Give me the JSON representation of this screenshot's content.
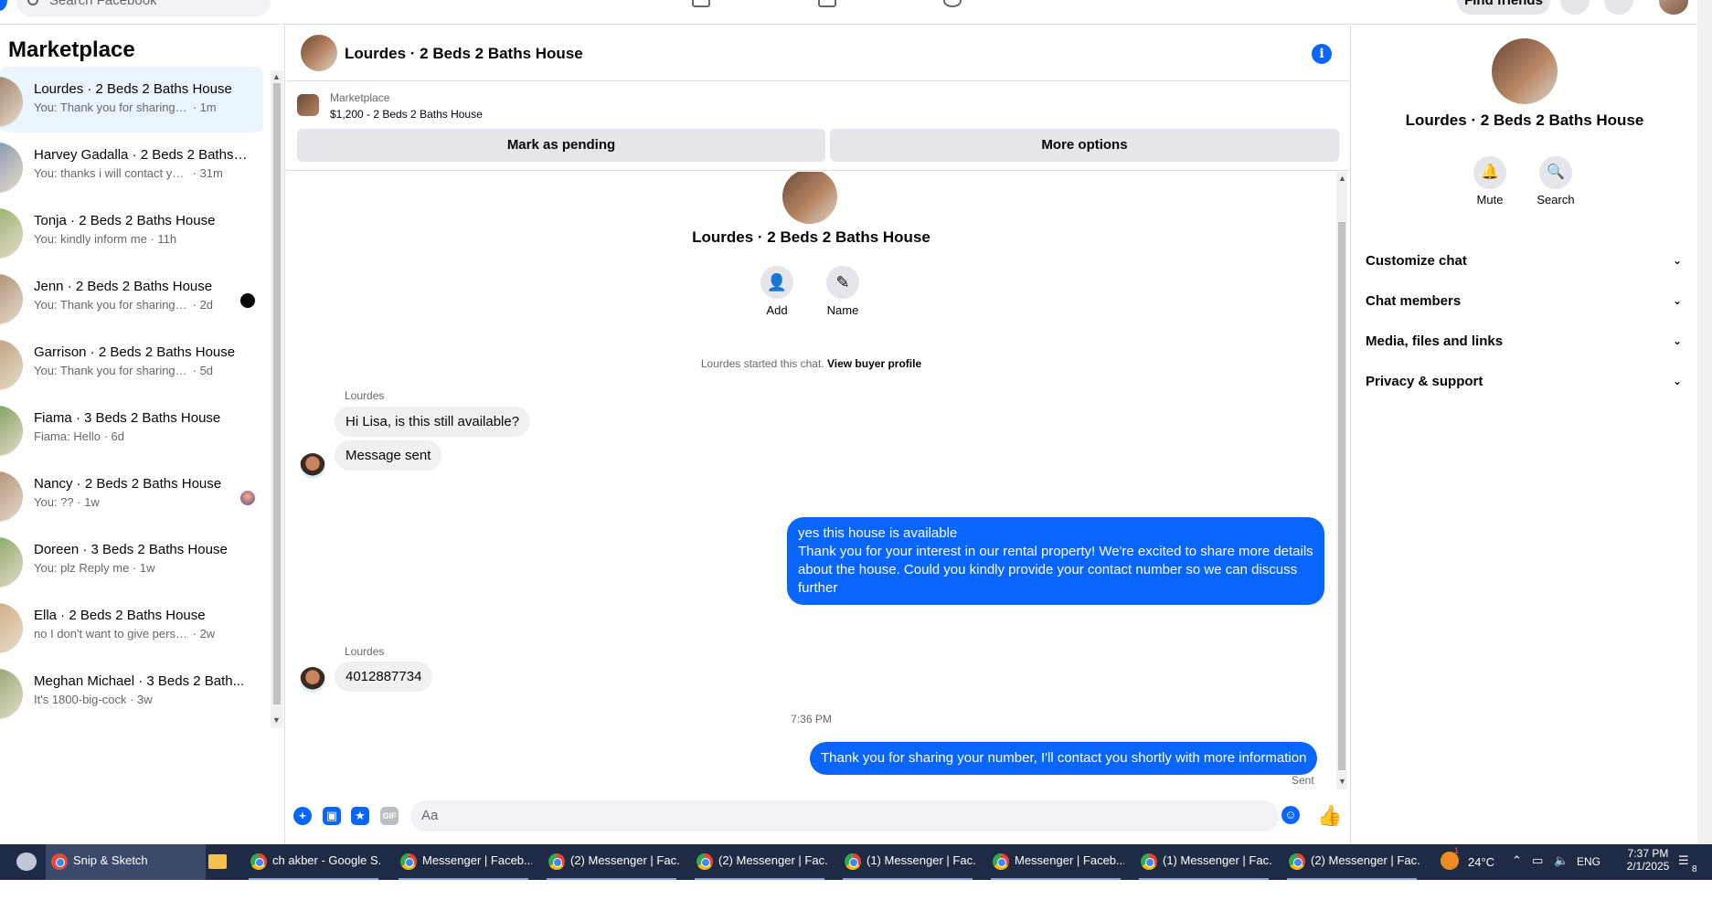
{
  "topbar": {
    "search_placeholder": "Search Facebook",
    "find_friends": "Find friends"
  },
  "sidebar": {
    "title": "Marketplace",
    "chats": [
      {
        "name": "Lourdes · 2 Beds 2 Baths House",
        "preview": "You: Thank you for sharing your n...",
        "time": "· 1m",
        "active": true,
        "color": "#8a6a52"
      },
      {
        "name": "Harvey Gadalla · 2 Beds 2 Baths ...",
        "preview": "You: thanks i will contact you as s...",
        "time": "· 31m",
        "color": "#6a86a8"
      },
      {
        "name": "Tonja · 2 Beds 2 Baths House",
        "preview": "You: kindly inform me",
        "time": "· 11h",
        "color": "#7fa756"
      },
      {
        "name": "Jenn · 2 Beds 2 Baths House",
        "preview": "You: Thank you for sharing your ...",
        "time": "· 2d",
        "color": "#9c7a5f",
        "badge": "dot"
      },
      {
        "name": "Garrison · 2 Beds 2 Baths House",
        "preview": "You: Thank you for sharing your nu...",
        "time": "· 5d",
        "color": "#b39068"
      },
      {
        "name": "Fiama · 3 Beds 2 Baths House",
        "preview": "Fiama: Hello",
        "time": "· 6d",
        "color": "#5f8f3f"
      },
      {
        "name": "Nancy · 2 Beds 2 Baths House",
        "preview": "You: ??",
        "time": "· 1w",
        "color": "#a07a60",
        "badge": "avatar"
      },
      {
        "name": "Doreen · 3 Beds 2 Baths House",
        "preview": "You: plz Reply me",
        "time": "· 1w",
        "color": "#6b9a4a"
      },
      {
        "name": "Ella · 2 Beds 2 Baths House",
        "preview": "no I don't want to give personal in...",
        "time": "· 2w",
        "color": "#c8a070"
      },
      {
        "name": "Meghan Michael · 3 Beds 2 Bath...",
        "preview": "It's 1800-big-cock",
        "time": "· 3w",
        "color": "#7a9a5a"
      }
    ]
  },
  "conversation": {
    "title": "Lourdes · 2 Beds 2 Baths House",
    "marketplace_label": "Marketplace",
    "listing": "$1,200 - 2 Beds 2 Baths House",
    "mark_pending": "Mark as pending",
    "more_options": "More options",
    "add_label": "Add",
    "name_label": "Name",
    "started_text": "Lourdes started this chat.",
    "view_buyer": "View buyer profile",
    "sender1": "Lourdes",
    "msg1": "Hi Lisa, is this still available?",
    "msg2": "Message sent",
    "out1_line1": "yes this house is available",
    "out1_line2": "Thank you for your interest in our rental property! We're excited to share more details about the house. Could you kindly provide your contact number so we can discuss further",
    "sender2": "Lourdes",
    "msg3": "4012887734",
    "timestamp": "7:36 PM",
    "out2": "Thank you for sharing your number, I'll contact you shortly with more information",
    "status": "Sent",
    "composer_placeholder": "Aa"
  },
  "right_panel": {
    "title": "Lourdes · 2 Beds 2 Baths House",
    "mute": "Mute",
    "search": "Search",
    "sections": [
      "Customize chat",
      "Chat members",
      "Media, files and links",
      "Privacy & support"
    ]
  },
  "taskbar": {
    "items": [
      {
        "label": "Snip & Sketch",
        "active": true
      },
      {
        "label": "ch akber - Google S..."
      },
      {
        "label": "Messenger | Faceb..."
      },
      {
        "label": "(2) Messenger | Fac..."
      },
      {
        "label": "(2) Messenger | Fac..."
      },
      {
        "label": "(1) Messenger | Fac..."
      },
      {
        "label": "Messenger | Faceb..."
      },
      {
        "label": "(1) Messenger | Fac..."
      },
      {
        "label": "(2) Messenger | Fac..."
      }
    ],
    "weather": "24°C",
    "lang": "ENG",
    "time": "7:37 PM",
    "date": "2/1/2025",
    "notif_count": "8",
    "weather_badge": "1"
  }
}
